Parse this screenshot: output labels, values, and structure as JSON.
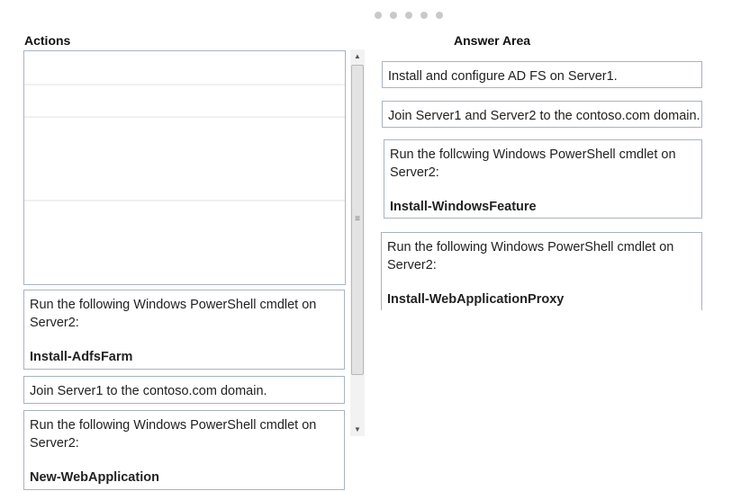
{
  "actions": {
    "heading": "Actions",
    "items": [
      {
        "line1": "Run the following Windows PowerShell cmdlet on",
        "line2": "Server2:",
        "cmd": "Install-AdfsFarm"
      },
      {
        "line1": "Join Server1 to the contoso.com domain."
      },
      {
        "line1": "Run the following Windows PowerShell cmdlet on",
        "line2": "Server2:",
        "cmd": "New-WebApplication"
      }
    ]
  },
  "answer": {
    "heading": "Answer Area",
    "items": [
      {
        "line1": "Install and configure AD FS on Server1."
      },
      {
        "line1": "Join Server1 and Server2 to the contoso.com domain."
      },
      {
        "line1": "Run the follcwing Windows PowerShell cmdlet on",
        "line2": "Server2:",
        "cmd": "Install-WindowsFeature"
      },
      {
        "line1": "Run the following Windows PowerShell cmdlet on",
        "line2": "Server2:",
        "cmd": "Install-WebApplicationProxy"
      }
    ]
  },
  "scrollbar": {
    "up_glyph": "▲",
    "down_glyph": "▼",
    "grip_glyph": "≡"
  },
  "pager": {
    "dot_count": 5
  }
}
